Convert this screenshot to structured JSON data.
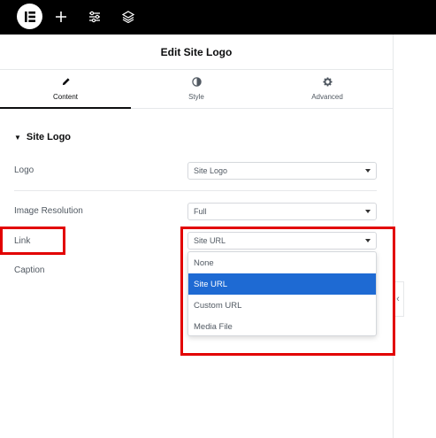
{
  "topbar": {
    "icons": [
      "elementor-logo-icon",
      "add-icon",
      "sliders-icon",
      "layers-icon"
    ]
  },
  "panel": {
    "title": "Edit Site Logo",
    "tabs": [
      {
        "label": "Content",
        "icon": "pencil-icon",
        "active": true
      },
      {
        "label": "Style",
        "icon": "contrast-icon",
        "active": false
      },
      {
        "label": "Advanced",
        "icon": "gear-icon",
        "active": false
      }
    ],
    "section": {
      "title": "Site Logo"
    },
    "fields": {
      "logo": {
        "label": "Logo",
        "value": "Site Logo"
      },
      "resolution": {
        "label": "Image Resolution",
        "value": "Full"
      },
      "link": {
        "label": "Link",
        "value": "Site URL"
      },
      "caption": {
        "label": "Caption"
      }
    },
    "link_options": [
      "None",
      "Site URL",
      "Custom URL",
      "Media File"
    ],
    "link_selected": "Site URL"
  },
  "colors": {
    "accent_selected": "#1e6ad3",
    "highlight": "#e20000"
  }
}
